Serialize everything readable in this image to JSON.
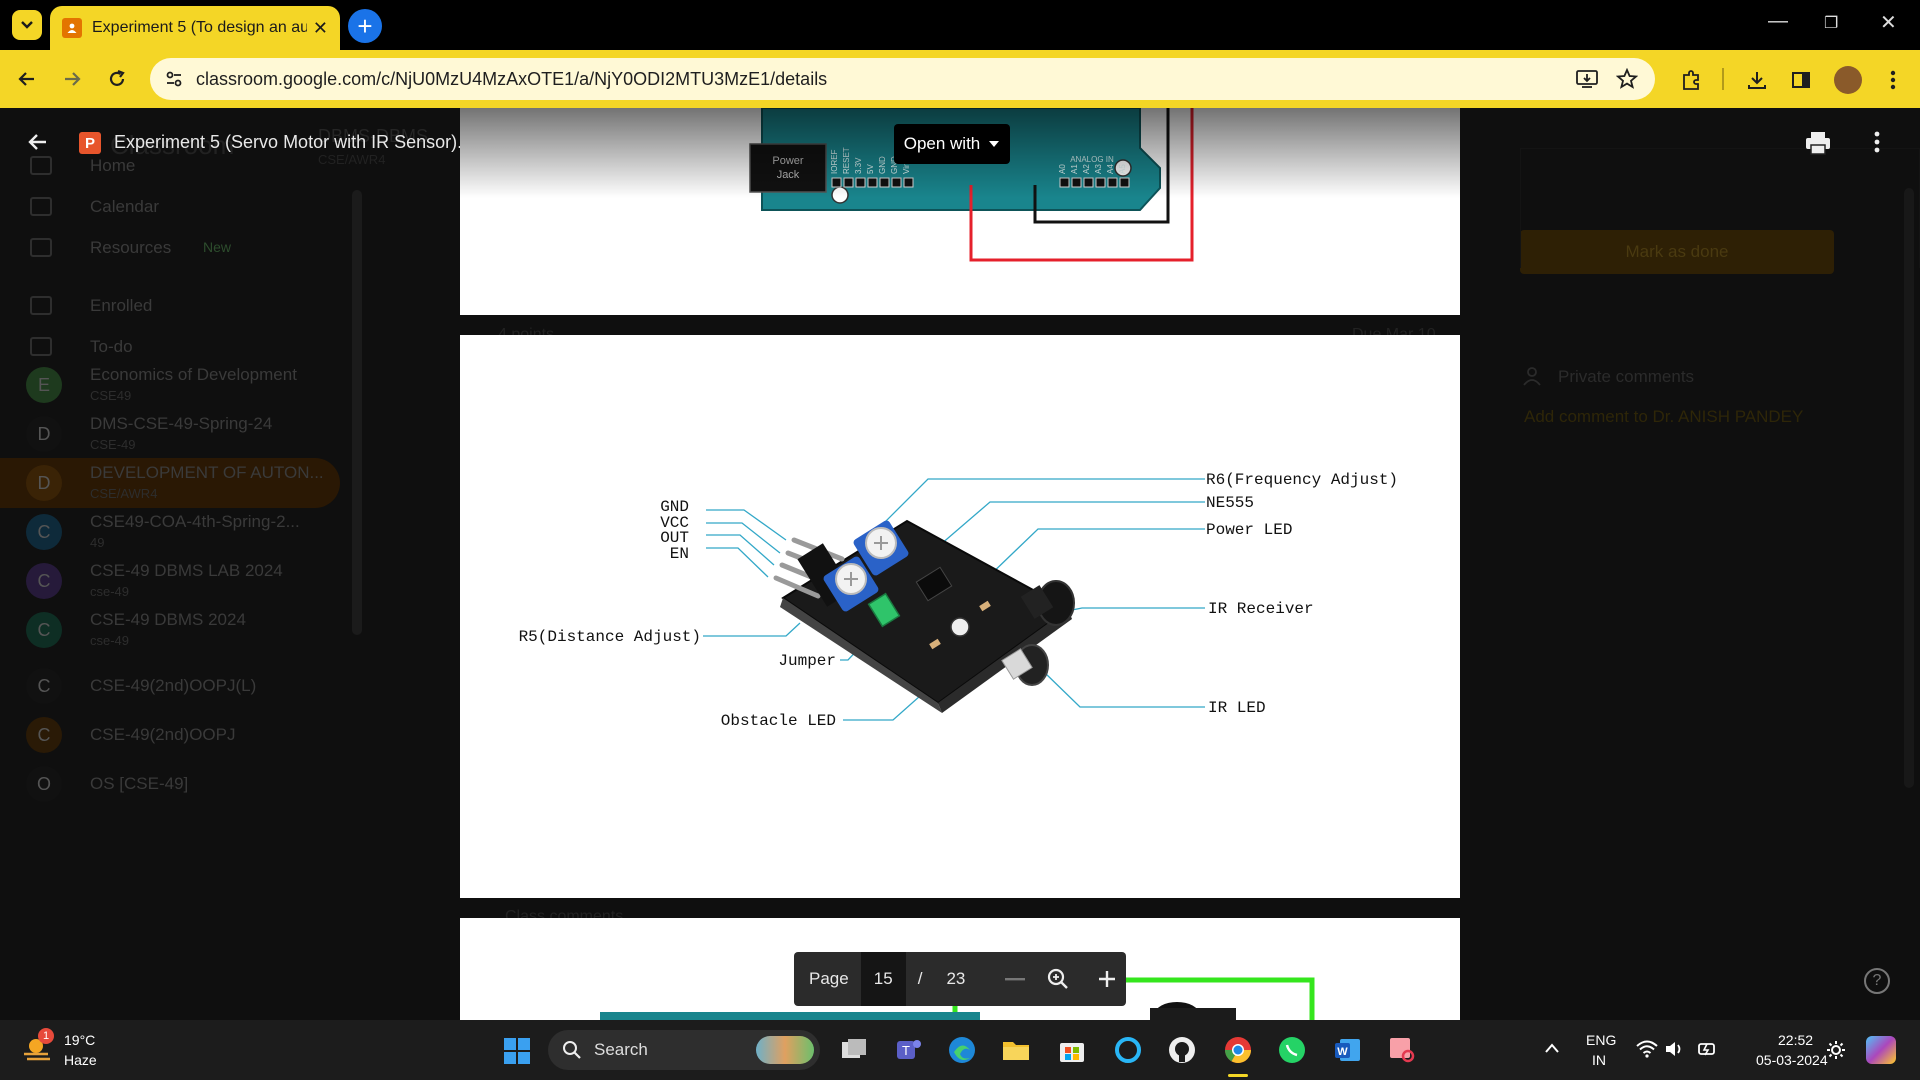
{
  "browser": {
    "tab_title": "Experiment 5 (To design an au",
    "url": "classroom.google.com/c/NjU0MzU4MzAxOTE1/a/NjY0ODI2MTU3MzE1/details"
  },
  "classroom": {
    "sidebar": [
      {
        "label": "Home"
      },
      {
        "label": "Calendar"
      },
      {
        "label": "Resources",
        "badge": "New"
      },
      {
        "label": "Enrolled"
      },
      {
        "label": "To-do"
      },
      {
        "label": "Economics of Development",
        "sub": "CSE49",
        "letter": "E"
      },
      {
        "label": "DMS-CSE-49-Spring-24",
        "sub": "CSE-49",
        "letter": "D"
      },
      {
        "label": "DEVELOPMENT OF AUTON...",
        "sub": "CSE/AWR4",
        "letter": "D"
      },
      {
        "label": "CSE49-COA-4th-Spring-2...",
        "sub": "49",
        "letter": "C"
      },
      {
        "label": "CSE-49 DBMS LAB 2024",
        "sub": "cse-49",
        "letter": "C"
      },
      {
        "label": "CSE-49 DBMS 2024",
        "sub": "cse-49",
        "letter": "C"
      },
      {
        "label": "CSE-49(2nd)OOPJ(L)",
        "sub": "",
        "letter": "C"
      },
      {
        "label": "CSE-49(2nd)OOPJ",
        "sub": "",
        "letter": "C"
      },
      {
        "label": "OS [CSE-49]",
        "sub": "",
        "letter": "O"
      }
    ],
    "header_course": "DBMS-DBMS",
    "header_section": "CSE/AWR4",
    "logo_text": "Classroom",
    "mark_done": "Mark as done",
    "points": "4 points",
    "due": "Due Mar 10",
    "private_comments": "Private comments",
    "add_comment": "Add comment to Dr. ANISH PANDEY",
    "class_comments": "Class comments"
  },
  "viewer": {
    "file_name": "Experiment 5 (Servo Motor with IR Sensor).pptx",
    "open_with": "Open with",
    "page_label": "Page",
    "page_current": "15",
    "page_sep": "/",
    "page_total": "23"
  },
  "slide_top": {
    "power_jack": [
      "Power",
      "Jack"
    ],
    "pins": [
      "IOREF",
      "RESET",
      "3.3V",
      "5V",
      "GND",
      "GND",
      "Vin"
    ],
    "analog_header": "ANALOG IN",
    "analog_pins": [
      "A0",
      "A1",
      "A2",
      "A3",
      "A4",
      "A5"
    ]
  },
  "sensor_labels": {
    "gnd": "GND",
    "vcc": "VCC",
    "out": "OUT",
    "en": "EN",
    "r5": "R5(Distance Adjust)",
    "jumper": "Jumper",
    "obstacle": "Obstacle LED",
    "r6": "R6(Frequency Adjust)",
    "ne555": "NE555",
    "power_led": "Power LED",
    "ir_receiver": "IR Receiver",
    "ir_led": "IR LED"
  },
  "taskbar": {
    "notif_count": "1",
    "temperature": "19°C",
    "weather": "Haze",
    "search": "Search",
    "lang": "ENG",
    "region": "IN",
    "time": "22:52",
    "date": "05-03-2024"
  },
  "colors": {
    "chrome_yellow": "#f4d626",
    "board_teal": "#19858d",
    "wire_red": "#e5202b",
    "wire_green": "#35e61d"
  }
}
